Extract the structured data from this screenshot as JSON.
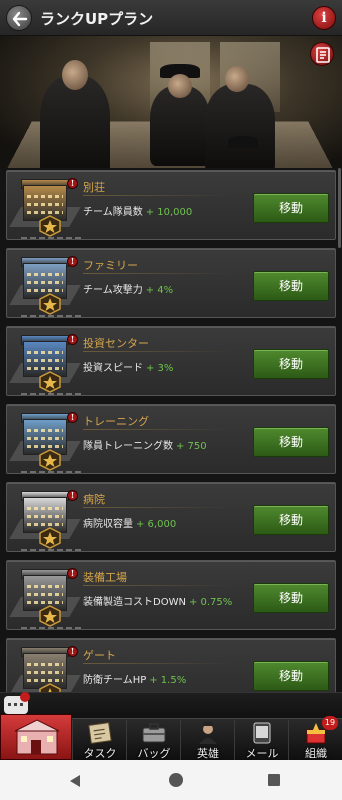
{
  "header": {
    "title": "ランクUPプラン",
    "info_symbol": "i"
  },
  "buildings": [
    {
      "name": "別荘",
      "stat_label": "チーム隊員数",
      "bonus": "+ 10,000",
      "button": "移動",
      "color": "#b58a4a"
    },
    {
      "name": "ファミリー",
      "stat_label": "チーム攻撃力",
      "bonus": "+ 4%",
      "button": "移動",
      "color": "#7fa0c4"
    },
    {
      "name": "投資センター",
      "stat_label": "投資スピード",
      "bonus": "+ 3%",
      "button": "移動",
      "color": "#5a88c2"
    },
    {
      "name": "トレーニング",
      "stat_label": "隊員トレーニング数",
      "bonus": "+ 750",
      "button": "移動",
      "color": "#6f9ec9"
    },
    {
      "name": "病院",
      "stat_label": "病院収容量",
      "bonus": "+ 6,000",
      "button": "移動",
      "color": "#d9d9d9"
    },
    {
      "name": "装備工場",
      "stat_label": "装備製造コストDOWN",
      "bonus": "+ 0.75%",
      "button": "移動",
      "color": "#9a9a9a"
    },
    {
      "name": "ゲート",
      "stat_label": "防衛チームHP",
      "bonus": "+ 1.5%",
      "button": "移動",
      "color": "#8a8070"
    }
  ],
  "chat": {
    "badge": ""
  },
  "nav": {
    "items": [
      {
        "label": "タスク",
        "icon": "task-icon"
      },
      {
        "label": "バッグ",
        "icon": "bag-icon"
      },
      {
        "label": "英雄",
        "icon": "hero-icon"
      },
      {
        "label": "メール",
        "icon": "mail-icon"
      },
      {
        "label": "組織",
        "icon": "guild-icon"
      }
    ],
    "guild_badge": "19"
  },
  "colors": {
    "accent_gold": "#d6a64a",
    "bonus_green": "#6ec24e",
    "button_green": "#3f7a22",
    "home_red": "#c42a2a"
  }
}
